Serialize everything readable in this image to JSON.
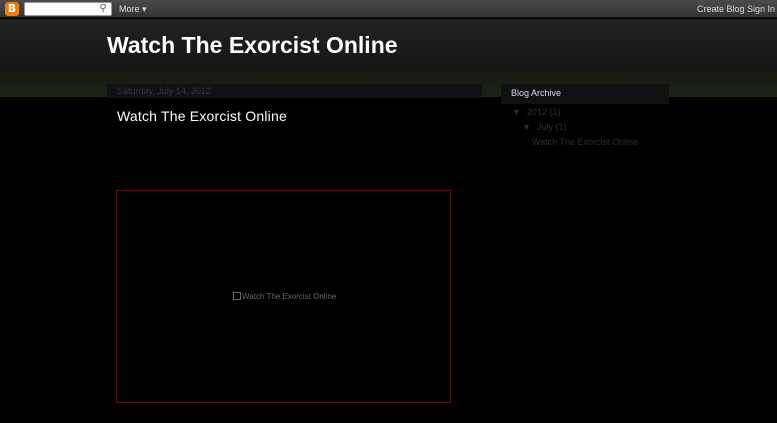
{
  "navbar": {
    "logo_letter": "B",
    "search_icon": "⚲",
    "more_label": "More",
    "more_arrow": "▾",
    "create_blog": "Create Blog",
    "sign_in": "Sign In"
  },
  "header": {
    "blog_title": "Watch The Exorcist Online"
  },
  "post": {
    "date": "Saturday, July 14, 2012",
    "title": "Watch The Exorcist Online",
    "image_alt": "Watch The Exorcist Online"
  },
  "sidebar": {
    "widget_title": "Blog Archive",
    "archive": [
      {
        "arrow": "▼",
        "label": "2012",
        "count": "(1)"
      },
      {
        "arrow": "▼",
        "label": "July",
        "count": "(1)"
      },
      {
        "label": "Watch The Exorcist Online"
      }
    ]
  },
  "colors": {
    "background": "#000000",
    "navbar": "#3f3f3f",
    "blogger_orange": "#f57d00",
    "image_border": "#5a1313",
    "dim_text": "#2e2e2e"
  }
}
